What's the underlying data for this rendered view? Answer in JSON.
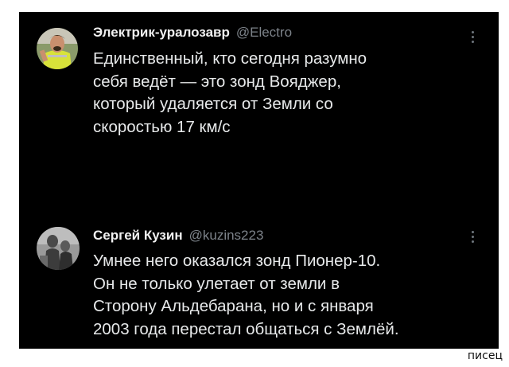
{
  "tweets": [
    {
      "name": "Электрик-уралозавр",
      "handle": "@Electro",
      "avatar_icon": "user-avatar-photo",
      "more_icon": "more-options-vertical-dots",
      "lines": [
        "Единственный, кто сегодня разумно",
        "себя ведёт — это зонд Вояджер,",
        "который удаляется от Земли со",
        "скоростью 17 км/с"
      ]
    },
    {
      "name": "Сергей Кузин",
      "handle": "@kuzins223",
      "avatar_icon": "user-avatar-photo",
      "more_icon": "more-options-vertical-dots",
      "lines": [
        "Умнее него оказался зонд Пионер-10.",
        "Он не только улетает от земли в",
        "Сторону Альдебарана,  но и с января",
        "2003 года перестал общаться с Землёй."
      ]
    }
  ],
  "watermark": "писец",
  "colors": {
    "background": "#000000",
    "name": "#f1f1f1",
    "handle": "#7d838a",
    "body": "#e7e9ea"
  }
}
